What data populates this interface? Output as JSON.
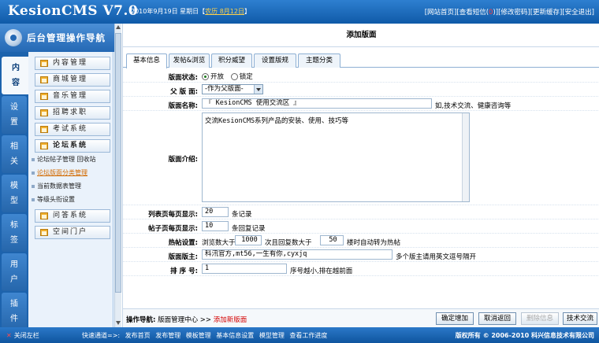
{
  "header": {
    "logo": "KesionCMS V7.0",
    "date": "2010年9月19日 星期日【",
    "lunar": "农历 8月12日",
    "date_end": "】",
    "links": [
      "[网站首页]",
      "[查看短信(",
      ")]",
      "[修改密码]",
      "[更新缓存]",
      "[安全退出]"
    ],
    "msg_count": "0"
  },
  "nav": {
    "title": "后台管理操作导航",
    "categories": [
      "内容",
      "设置",
      "相关",
      "模型",
      "标签",
      "用户",
      "插件"
    ],
    "menu": [
      "内容管理",
      "商城管理",
      "音乐管理",
      "招聘求职",
      "考试系统",
      "论坛系统",
      "问答系统",
      "空间门户"
    ],
    "forum_sub": [
      "论坛帖子管理 回收站",
      "论坛版面分类管理",
      "当前数据表管理",
      "等级头衔设置"
    ]
  },
  "main": {
    "title": "添加版面",
    "tabs": [
      "基本信息",
      "发帖&浏览",
      "积分威望",
      "设置版规",
      "主题分类"
    ],
    "fields": {
      "status_label": "版面状态:",
      "status_open": "开放",
      "status_locked": "锁定",
      "parent_label": "父 版 面:",
      "parent_value": "-作为父版面-",
      "name_label": "版面名称:",
      "name_value": "『 KesionCMS 使用交流区 』",
      "name_hint": "如,技术交流、健康咨询等",
      "intro_label": "版面介绍:",
      "intro_value": "交流KesionCMS系列产品的安装、使用、技巧等",
      "list_label": "列表页每页显示:",
      "list_value": "20",
      "list_unit": "条记录",
      "post_label": "帖子页每页显示:",
      "post_value": "10",
      "post_unit": "条回复记录",
      "hot_label": "热帖设置:",
      "hot_text1": "浏览数大于",
      "hot_views": "1000",
      "hot_text2": "次且回复数大于",
      "hot_replies": "50",
      "hot_text3": "楼时自动转为热帖",
      "master_label": "版面版主:",
      "master_value": "科汛官方,mt56,一生有你,cyxjq",
      "master_hint": "多个版主请用英文逗号隔开",
      "order_label": "排 序 号:",
      "order_value": "1",
      "order_hint": "序号越小,排在越前面"
    },
    "opnav": {
      "label": "操作导航:",
      "path": "版面管理中心 >> ",
      "current": "添加新版面"
    },
    "buttons": [
      "确定增加",
      "取消返回",
      "删除信息",
      "技术交流"
    ]
  },
  "status": {
    "close": "关闭左栏",
    "quick_label": "快速通道=>:",
    "quick": [
      "发布首页",
      "发布管理",
      "模板管理",
      "基本信息设置",
      "模型管理",
      "查看工作进度"
    ],
    "copyright": "版权所有 © 2006-2010 科兴信息技术有限公司"
  }
}
